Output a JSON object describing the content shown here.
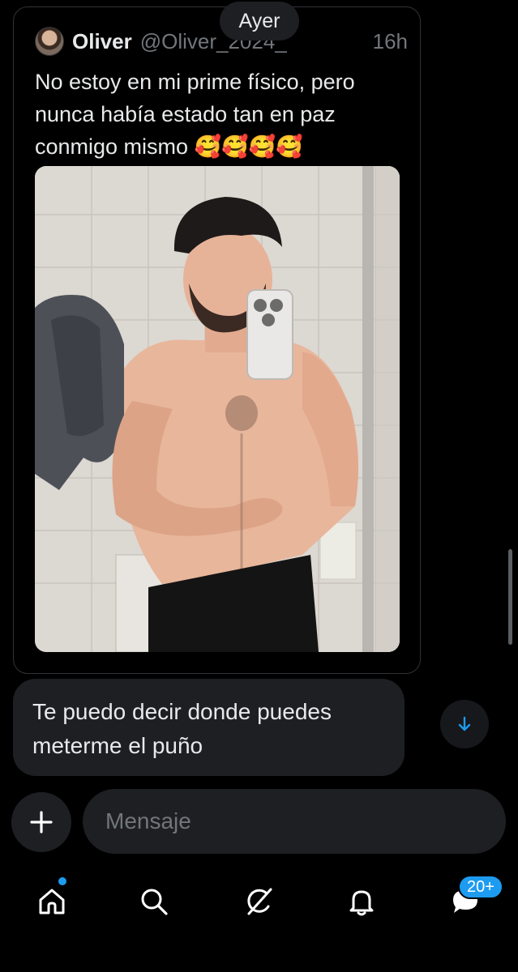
{
  "date_separator": "Ayer",
  "quoted_tweet": {
    "author_name": "Oliver",
    "author_handle": "@Oliver_2024_",
    "time": "16h",
    "text": "No estoy en mi prime físico, pero nunca había estado tan en paz conmigo mismo 🥰🥰🥰🥰"
  },
  "message": {
    "text": "Te puedo decir donde puedes meterme el puño"
  },
  "composer": {
    "placeholder": "Mensaje"
  },
  "nav": {
    "messages_badge": "20+"
  },
  "icons": {
    "add": "plus-icon",
    "scroll": "arrow-down-icon",
    "home": "home-icon",
    "search": "search-icon",
    "grok": "grok-icon",
    "notifications": "bell-icon",
    "messages": "message-bubble-icon"
  },
  "colors": {
    "accent": "#1d9bf0",
    "bubble": "#1d1f23",
    "muted": "#71767b"
  }
}
